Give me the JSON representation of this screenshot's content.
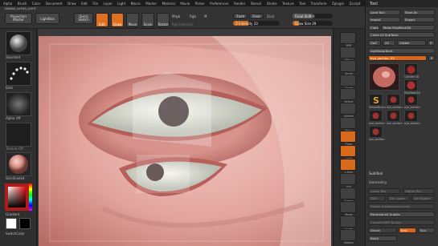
{
  "menu": [
    "Alpha",
    "Brush",
    "Color",
    "Document",
    "Draw",
    "Edit",
    "File",
    "Layer",
    "Light",
    "Macro",
    "Marker",
    "Material",
    "Movie",
    "Picker",
    "Preferences",
    "Render",
    "Stencil",
    "Stroke",
    "Texture",
    "Tool",
    "Transform",
    "Zplugin",
    "Zscript"
  ],
  "menu_right": "Menus  DefaultZScript",
  "toolbar": {
    "projection_master": "Projection Master",
    "quick_sketch": "Quick Sketch",
    "edit": "Edit",
    "draw": "Draw",
    "move": "Move",
    "scale": "Scale",
    "rotate": "Rotate",
    "mrgb": "Mrgb",
    "rgb": "Rgb",
    "m": "M",
    "zadd": "Zadd",
    "zsub": "Zsub",
    "zcut": "Zcut",
    "rgb_intensity": "Rgb Intensity",
    "z_intensity": "Z Intensity 33",
    "focal_shift": "Focal Shift 0",
    "draw_size": "Draw Size 29",
    "lightbox": "LightBox",
    "help_text": "MWBAS_ALPHA_LIGHT",
    "z_intensity_level": 0.33,
    "focal_shift_level": 0.5,
    "draw_size_level": 0.15
  },
  "left_shelf": {
    "brush_label": "Standard",
    "stroke_label": "Dots",
    "alpha_label": "Alpha Off",
    "texture_label": "Texture Off",
    "material_label": "SkinShade4",
    "gradient_label": "Gradient",
    "switch_color_label": "SwitchColor"
  },
  "right_shelf": [
    "BPR",
    "SPix 3",
    "Scroll",
    "Zoom",
    "Actual",
    "AAHalf",
    "Persp",
    "Floor",
    "Local",
    "L.Sym",
    "Xyz",
    "Frame",
    "Move",
    "Scale",
    "Rotate"
  ],
  "palette": {
    "title": "Tool",
    "load_tool": "Load Tool",
    "save_as": "Save As",
    "import": "Import",
    "export": "Export",
    "clone": "Clone",
    "make_polymesh": "Make PolyMesh3D",
    "clone_all_subtools": "Clone All SubTools",
    "goz": "GoZ",
    "all": "All",
    "visible": "Visible",
    "r": "R",
    "lightbox_tools": "Lightbox▸Tools",
    "current_tool": "eye_section. 55",
    "r2": "R",
    "thumb_labels": [
      "Cylinder3D",
      "PolyMesh3D",
      "SimpleBrush",
      "eye_section",
      "eye_section",
      "eye_section",
      "eye_section",
      "eye_section",
      "eye_section"
    ],
    "subtool": "SubTool",
    "geometry": "Geometry",
    "lower_res": "Lower Res",
    "higher_res": "Higher Res",
    "sdiv": "SDiv",
    "del_lower": "Del Lower",
    "del_higher": "Del Higher",
    "freeze_subdivision": "Freeze SubDivision Levels",
    "reconstruct_subdiv": "Reconstruct Subdiv",
    "convert_bpr": "Convert BPR To Geo",
    "divide": "Divide",
    "smt": "Smt",
    "suv": "Suv",
    "reuv": "ReUV"
  },
  "colors": {
    "accent": "#e07020",
    "panel": "#353535",
    "skin": "#e8b7b0"
  }
}
